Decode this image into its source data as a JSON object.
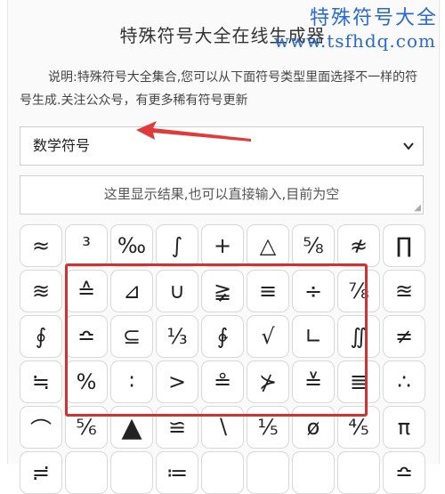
{
  "page": {
    "title": "特殊符号大全在线生成器",
    "description": "说明:特殊符号大全集合,您可以从下面符号类型里面选择不一样的符号生成.关注公众号，有更多稀有符号更新"
  },
  "watermark": {
    "title": "特殊符号大全",
    "url": "www.tsfhdq.com"
  },
  "category_select": {
    "selected": "数学符号",
    "chevron_icon": "chevron-down-icon"
  },
  "result_box": {
    "placeholder": "这里显示结果,也可以直接输入,目前为空"
  },
  "colors": {
    "highlight": "#d23131",
    "arrow": "#e03a3a",
    "watermark": "#2a6ad0"
  },
  "symbols": [
    [
      "≈",
      "³",
      "‰",
      "∫",
      "+",
      "△",
      "⅝",
      "≉",
      "∏"
    ],
    [
      "≋",
      "≙",
      "⊿",
      "∪",
      "≩",
      "≡",
      "÷",
      "⅞",
      "≊"
    ],
    [
      "∮",
      "≏",
      "⊆",
      "⅓",
      "∲",
      "√",
      "∟",
      "∬",
      "≠"
    ],
    [
      "≒",
      "%",
      "∶",
      ">",
      "≗",
      "⊁",
      "≚",
      "≣",
      "∴"
    ],
    [
      "⌒",
      "⅚",
      "▲",
      "≌",
      "∖",
      "⅕",
      "ø",
      "⅘",
      "π"
    ],
    [
      "≓",
      "",
      "",
      "≔",
      "",
      "",
      "",
      "",
      "≏"
    ]
  ]
}
